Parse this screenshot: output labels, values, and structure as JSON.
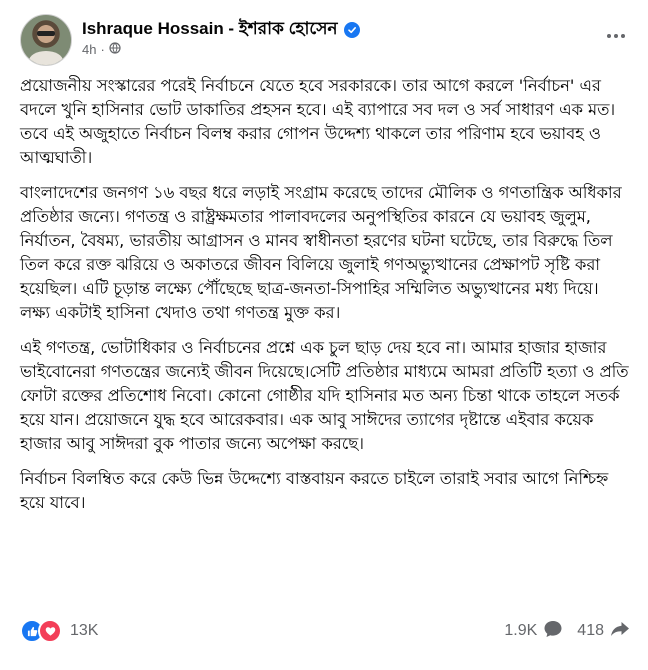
{
  "post": {
    "author": "Ishraque Hossain - ইশরাক হোসেন",
    "time": "4h",
    "paragraphs": [
      "প্রয়োজনীয় সংস্কারের পরেই নির্বাচনে যেতে হবে সরকারকে। তার আগে করলে 'নির্বাচন' এর বদলে খুনি হাসিনার ভোট ডাকাতির প্রহসন হবে। এই ব্যাপারে সব দল ও সর্ব সাধারণ এক মত। তবে এই অজুহাতে নির্বাচন বিলম্ব করার গোপন উদ্দেশ্য থাকলে তার পরিণাম হবে ভয়াবহ ও আত্মঘাতী।",
      "বাংলাদেশের জনগণ ১৬ বছর ধরে লড়াই সংগ্রাম করেছে তাদের মৌলিক ও গণতান্ত্রিক অধিকার প্রতিষ্ঠার জন্যে। গণতন্ত্র ও রাষ্ট্রক্ষমতার পালাবদলের অনুপস্থিতির কারনে যে ভয়াবহ জুলুম, নির্যাতন, বৈষম্য, ভারতীয় আগ্রাসন ও মানব স্বাধীনতা হরণের ঘটনা ঘটেছে, তার বিরুদ্ধে তিল তিল করে রক্ত ঝরিয়ে ও অকাতরে জীবন বিলিয়ে জুলাই গণঅভ্যুত্থানের প্রেক্ষাপট সৃষ্টি করা হয়েছিল। এটি চূড়ান্ত লক্ষ্যে পৌঁছেছে ছাত্র-জনতা-সিপাহির সম্মিলিত অভ্যুত্থানের মধ্য দিয়ে। লক্ষ্য একটাই হাসিনা খেদাও তথা গণতন্ত্র মুক্ত কর।",
      "এই গণতন্ত্র, ভোটাধিকার ও নির্বাচনের প্রশ্নে এক চুল ছাড় দেয় হবে না। আমার হাজার হাজার ভাইবোনেরা গণতন্ত্রের জন্যেই জীবন দিয়েছে।সেটি প্রতিষ্ঠার মাধ্যমে আমরা প্রতিটি হত্যা ও প্রতি ফোটা রক্তের প্রতিশোধ নিবো। কোনো গোষ্ঠীর যদি হাসিনার মত অন্য চিন্তা থাকে তাহলে সতর্ক হয়ে যান। প্রয়োজনে যুদ্ধ হবে আরেকবার। এক আবু সাঈদের ত্যাগের দৃষ্টান্তে এইবার কয়েক হাজার আবু সাঈদরা বুক পাতার জন্যে অপেক্ষা করছে।",
      "নির্বাচন বিলম্বিত করে কেউ ভিন্ন উদ্দেশ্যে বাস্তবায়ন করতে চাইলে তারাই সবার আগে নিশ্চিহ্ন হয়ে যাবে।"
    ]
  },
  "footer": {
    "reactions_count": "13K",
    "comments_count": "1.9K",
    "shares_count": "418"
  },
  "icons": {
    "verified": "verified-badge-icon",
    "privacy": "globe-icon",
    "menu": "more-options-icon",
    "like": "like-reaction-icon",
    "love": "love-reaction-icon",
    "comment": "comment-icon",
    "share": "share-icon"
  },
  "colors": {
    "brand_blue": "#1877f2",
    "love_red": "#f33e58",
    "meta_gray": "#65676b",
    "text": "#050505"
  }
}
